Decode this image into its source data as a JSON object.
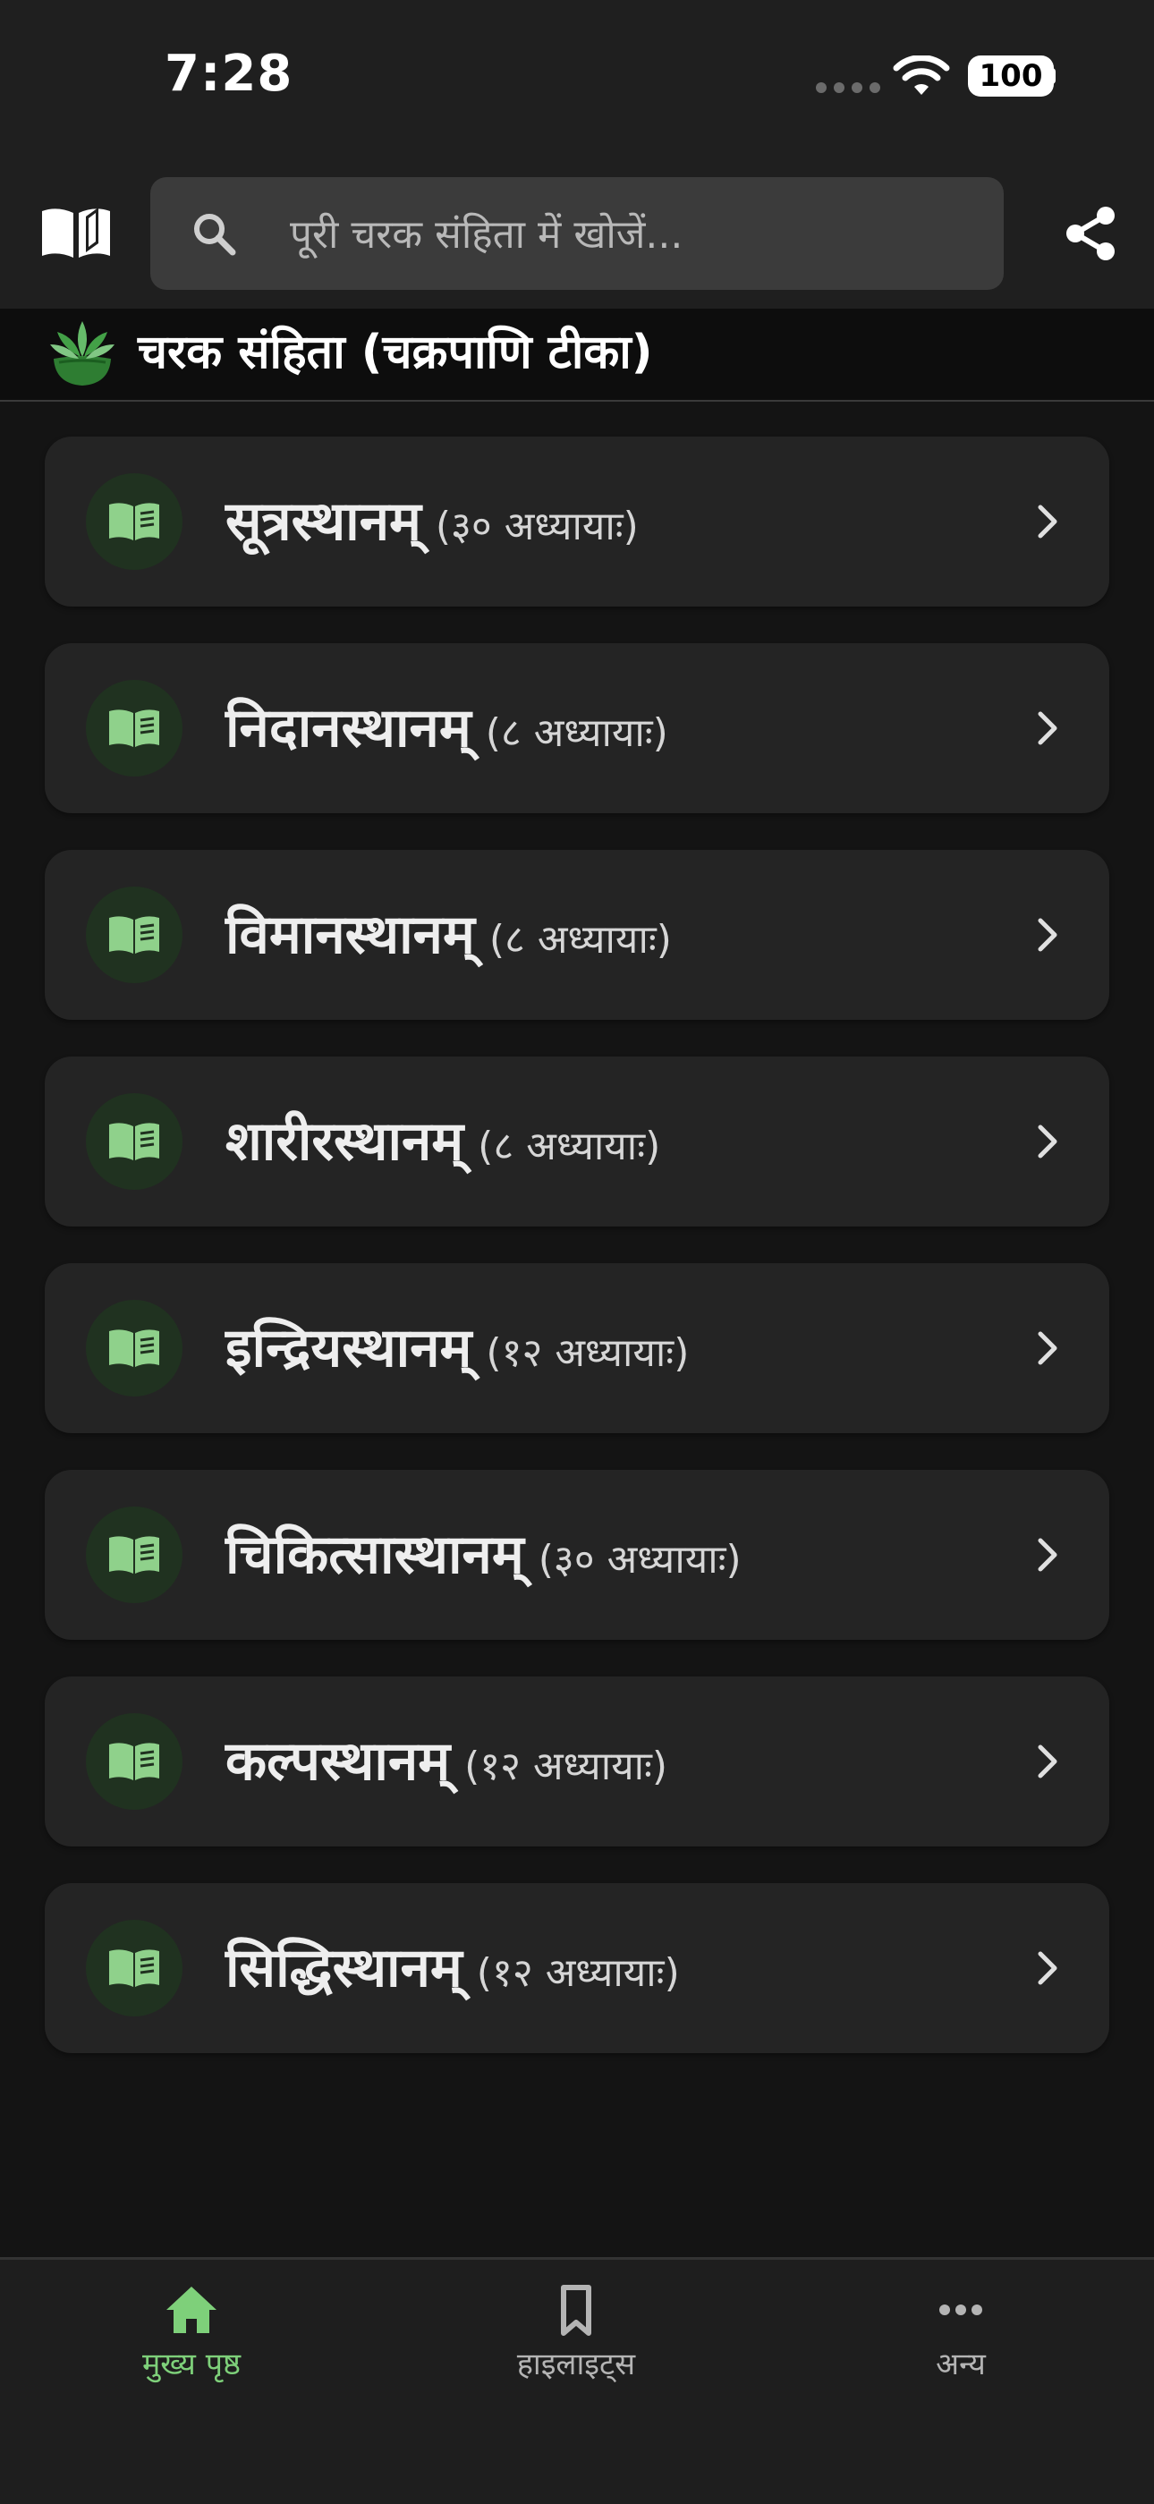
{
  "status_bar": {
    "time": "7:28",
    "battery": "100"
  },
  "search": {
    "placeholder": "पूरी चरक संहिता में खोजें..."
  },
  "header": {
    "title": "चरक संहिता (चक्रपाणि टीका)"
  },
  "sections": [
    {
      "name": "सूत्रस्थानम्",
      "count": "(३० अध्यायाः)"
    },
    {
      "name": "निदानस्थानम्",
      "count": "(८ अध्यायाः)"
    },
    {
      "name": "विमानस्थानम्",
      "count": "(८ अध्यायाः)"
    },
    {
      "name": "शारीरस्थानम्",
      "count": "(८ अध्यायाः)"
    },
    {
      "name": "इन्द्रियस्थानम्",
      "count": "(१२ अध्यायाः)"
    },
    {
      "name": "चिकित्सास्थानम्",
      "count": "(३० अध्यायाः)"
    },
    {
      "name": "कल्पस्थानम्",
      "count": "(१२ अध्यायाः)"
    },
    {
      "name": "सिद्धिस्थानम्",
      "count": "(१२ अध्यायाः)"
    }
  ],
  "bottom_nav": {
    "home": "मुख्य पृष्ठ",
    "highlights": "हाइलाइट्स",
    "other": "अन्य"
  },
  "colors": {
    "accent": "#7ed07a",
    "card_bg": "#242424",
    "icon_circle": "#203220",
    "page_bg": "#141414"
  },
  "icons": [
    "book-open-icon",
    "search-icon",
    "share-icon",
    "leaf-bowl-logo-icon",
    "book-icon",
    "chevron-right-icon",
    "home-icon",
    "bookmark-icon",
    "more-horizontal-icon",
    "wifi-icon"
  ]
}
